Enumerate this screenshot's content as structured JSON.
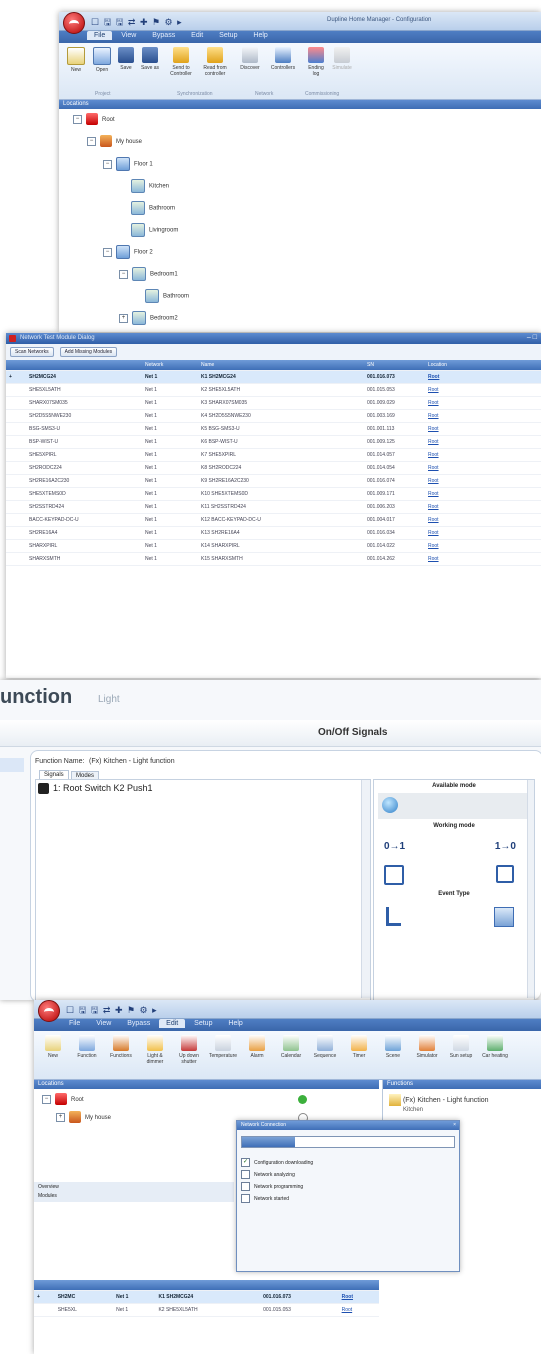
{
  "shot1": {
    "title": "Dupline Home Manager - Configuration",
    "quick_access": "☐ 🖫 🖫 ⇄ ✚ ⚑ ⚙ ▸",
    "menus": [
      "File",
      "View",
      "Bypass",
      "Edit",
      "Setup",
      "Help"
    ],
    "ribbon_buttons": [
      "New",
      "Open",
      "Save",
      "Save as",
      "Send to Controller",
      "Read from controller",
      "Discover",
      "Controllers",
      "Ending log",
      "Simulate"
    ],
    "ribbon_groups": [
      "Project",
      "Synchronization",
      "Network",
      "Commissioning"
    ],
    "panel_title": "Locations",
    "tree": [
      "Root",
      "My house",
      "Floor 1",
      "Kitchen",
      "Bathroom",
      "Livingroom",
      "Floor 2",
      "Bedroom1",
      "Bathroom",
      "Bedroom2"
    ]
  },
  "shot2": {
    "title": "Network Test Module Dialog",
    "buttons": [
      "Scan Networks",
      "Add Missing Modules"
    ],
    "columns": [
      "",
      "",
      "Network",
      "Name",
      "SN",
      "Location"
    ],
    "rows": [
      {
        "type": "SH2MCG24",
        "net": "Net 1",
        "name": "K1 SH2MCG24",
        "sn": "001.016.073",
        "loc": "Root"
      },
      {
        "type": "SHE5XL5ATH",
        "net": "Net 1",
        "name": "K2 SHE5XL5ATH",
        "sn": "001.015.053",
        "loc": "Root"
      },
      {
        "type": "SHARX07SM035",
        "net": "Net 1",
        "name": "K3 SHARX07SM035",
        "sn": "001.009.029",
        "loc": "Root"
      },
      {
        "type": "SH2D5S5NWE230",
        "net": "Net 1",
        "name": "K4 SH2D5S5NWE230",
        "sn": "001.003.169",
        "loc": "Root"
      },
      {
        "type": "BSG-SMS3-U",
        "net": "Net 1",
        "name": "K5 BSG-SMS3-U",
        "sn": "001.001.113",
        "loc": "Root"
      },
      {
        "type": "BSP-WIST-U",
        "net": "Net 1",
        "name": "K6 BSP-WIST-U",
        "sn": "001.009.125",
        "loc": "Root"
      },
      {
        "type": "SHE5XPIRL",
        "net": "Net 1",
        "name": "K7 SHE5XPIRL",
        "sn": "001.014.057",
        "loc": "Root"
      },
      {
        "type": "SH2RODC224",
        "net": "Net 1",
        "name": "K8 SH2RODC224",
        "sn": "001.014.054",
        "loc": "Root"
      },
      {
        "type": "SH2RE16A2C230",
        "net": "Net 1",
        "name": "K9 SH2RE16A2C230",
        "sn": "001.016.074",
        "loc": "Root"
      },
      {
        "type": "SHE5XTEMS0D",
        "net": "Net 1",
        "name": "K10 SHE5XTEMS0D",
        "sn": "001.009.171",
        "loc": "Root"
      },
      {
        "type": "SH2SSTRD424",
        "net": "Net 1",
        "name": "K11 SH2SSTRD424",
        "sn": "001.006.203",
        "loc": "Root"
      },
      {
        "type": "BACC-KEYPAD-DC-U",
        "net": "Net 1",
        "name": "K12 BACC-KEYPAD-DC-U",
        "sn": "001.004.017",
        "loc": "Root"
      },
      {
        "type": "SH2RE16A4",
        "net": "Net 1",
        "name": "K13 SH2RE16A4",
        "sn": "001.016.034",
        "loc": "Root"
      },
      {
        "type": "SHARXPIRL",
        "net": "Net 1",
        "name": "K14 SHARXPIRL",
        "sn": "001.014.022",
        "loc": "Root"
      },
      {
        "type": "SHARXSMTH",
        "net": "Net 1",
        "name": "K15 SHARXSMTH",
        "sn": "001.014.262",
        "loc": "Root"
      }
    ]
  },
  "shot3": {
    "title": "unction",
    "subtitle": "Light",
    "header": "On/Off Signals",
    "function_label": "Function Name:",
    "function_value": "(Fx) Kitchen - Light function",
    "tabs": [
      "Signals",
      "Modes"
    ],
    "signal": "1: Root Switch K2 Push1",
    "sections": [
      "Available mode",
      "Working mode",
      "Event Type"
    ],
    "working_modes": [
      "0→1",
      "1→0"
    ]
  },
  "shot4": {
    "menus": [
      "File",
      "View",
      "Bypass",
      "Edit",
      "Setup",
      "Help"
    ],
    "ribbon_buttons": [
      "New",
      "Function",
      "Functions",
      "Light & dimmer",
      "Up down shutter",
      "Temperature",
      "Alarm",
      "Calendar",
      "Sequence",
      "Timer",
      "Scene",
      "Simulator",
      "Sun setup",
      "Car heating"
    ],
    "panel_title": "Locations",
    "tree": [
      "Root",
      "My house"
    ],
    "right_panel_title": "Functions",
    "right_item": "(Fx) Kitchen - Light function",
    "right_item_sub": "Kitchen",
    "lower_tabs": [
      "Overview",
      "Modules"
    ],
    "dialog": {
      "title": "Network Connection",
      "steps": [
        {
          "label": "Configuration downloading",
          "done": true
        },
        {
          "label": "Network analyzing",
          "done": false
        },
        {
          "label": "Network programming",
          "done": false
        },
        {
          "label": "Network started",
          "done": false
        }
      ]
    },
    "rows": [
      {
        "type": "SH2MC",
        "net": "Net 1",
        "name": "K1 SH2MCG24",
        "sn": "001.016.073",
        "loc": "Root"
      },
      {
        "type": "SHE5XL",
        "net": "Net 1",
        "name": "K2 SHE5XL5ATH",
        "sn": "001.015.053",
        "loc": "Root"
      }
    ]
  }
}
